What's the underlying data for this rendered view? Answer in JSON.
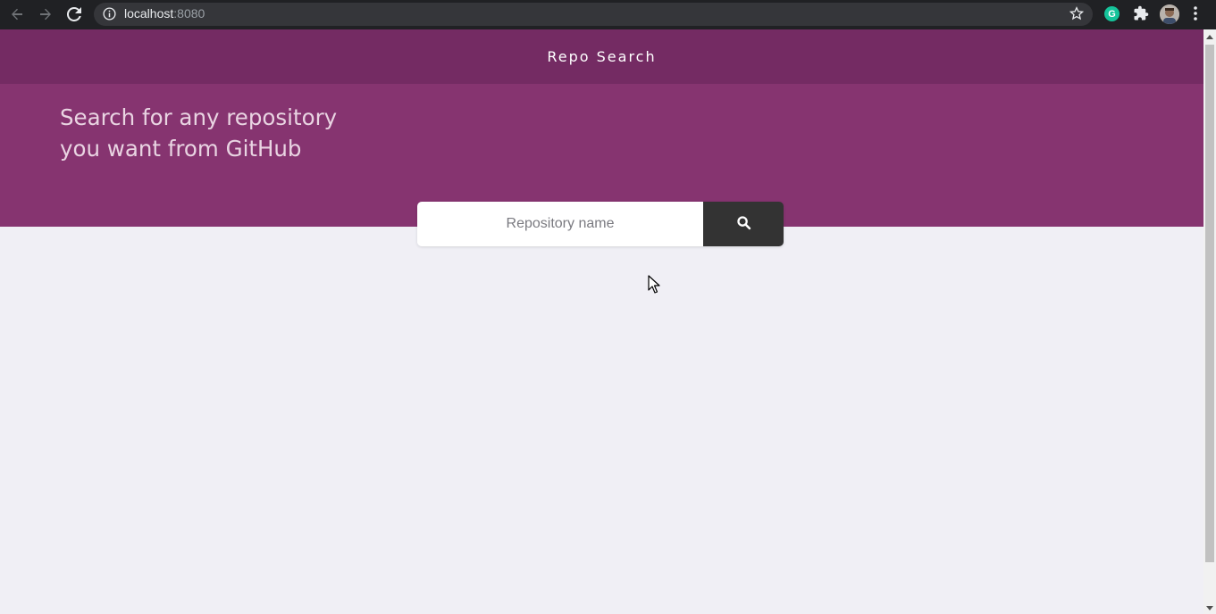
{
  "browser": {
    "url_host": "localhost",
    "url_port": ":8080",
    "back_icon": "arrow-left-icon",
    "forward_icon": "arrow-right-icon",
    "reload_icon": "reload-icon",
    "info_icon": "info-icon",
    "bookmark_icon": "star-icon",
    "extension_letter": "G"
  },
  "navbar": {
    "title": "Repo Search"
  },
  "hero": {
    "heading_line1": "Search for any repository",
    "heading_line2": "you want from GitHub"
  },
  "search": {
    "placeholder": "Repository name",
    "value": "",
    "button_icon": "search-icon"
  },
  "colors": {
    "navbar_bg": "#742b63",
    "hero_bg": "#863470",
    "page_bg": "#f0eff5",
    "button_bg": "#333333"
  }
}
